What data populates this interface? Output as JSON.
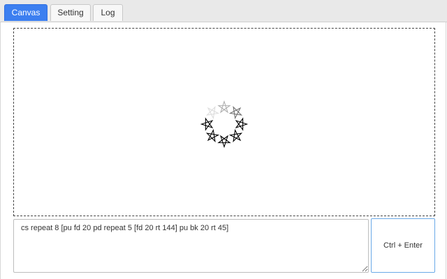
{
  "tabs": [
    {
      "label": "Canvas",
      "active": true
    },
    {
      "label": "Setting",
      "active": false
    },
    {
      "label": "Log",
      "active": false
    }
  ],
  "editor": {
    "code": "cs repeat 8 [pu fd 20 pd repeat 5 [fd 20 rt 144] pu bk 20 rt 45]"
  },
  "run_button": {
    "label": "Ctrl + Enter"
  },
  "turtle_drawing": {
    "shape": "pentagram",
    "count": 8,
    "stroke_color": "#000000",
    "fading_colors": [
      "#dddddd",
      "#b0b0b0",
      "#707070",
      "#000000",
      "#000000",
      "#000000",
      "#000000",
      "#000000"
    ]
  },
  "colors": {
    "accent": "#3c7ff0",
    "run_button_border": "#6aa9e8"
  }
}
